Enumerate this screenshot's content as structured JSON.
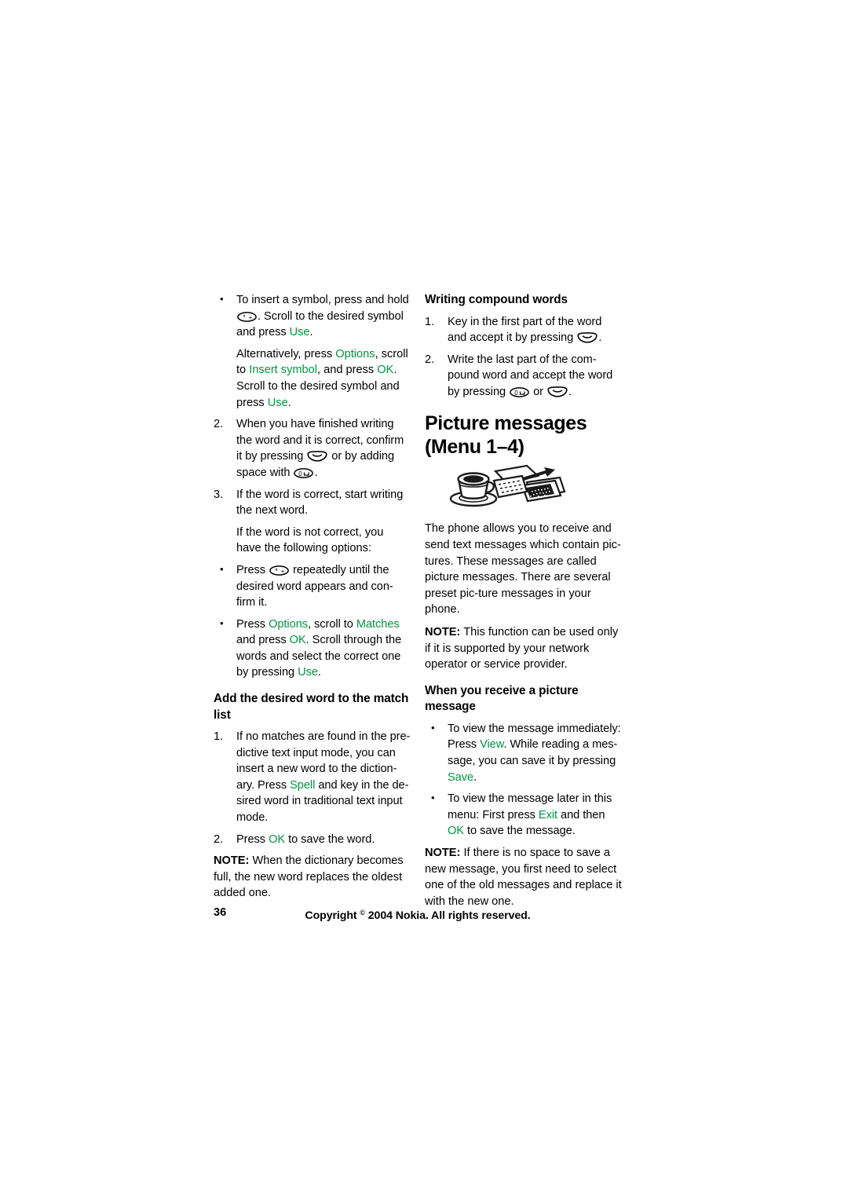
{
  "page": {
    "number": "36",
    "copyright_prefix": "Copyright",
    "copyright_symbol": "©",
    "copyright_suffix": "2004 Nokia. All rights reserved."
  },
  "accent_green": "#00963f",
  "left_column": {
    "bullet_insert_symbol": {
      "part1": "To insert a symbol, press and hold ",
      "key": "star-plus-key",
      "part2": ". Scroll to the desired symbol and press ",
      "link1": "Use",
      "part3": "."
    },
    "alternatively": {
      "part1": "Alternatively, press ",
      "link1": "Options",
      "part2": ", scroll to ",
      "link2": "Insert symbol",
      "part3": ", and press ",
      "link3": "OK",
      "part4": ". Scroll to the desired symbol and press ",
      "link4": "Use",
      "part5": "."
    },
    "step2": {
      "num": "2.",
      "part1": "When you have finished writing the word and it is correct, confirm it by pressing ",
      "key1": "select-key",
      "part2": " or by adding space with ",
      "key2": "zero-space-key",
      "part3": "."
    },
    "step3": {
      "num": "3.",
      "text": "If the word is correct, start writing the next word."
    },
    "not_correct": "If the word is not correct, you have the following options:",
    "bullet_press_star": {
      "part1": "Press ",
      "key": "star-plus-key",
      "part2": " repeatedly until the desired word appears and con-firm it."
    },
    "bullet_press_options": {
      "part1": "Press ",
      "link1": "Options",
      "part2": ", scroll to ",
      "link2": "Matches",
      "part3": " and press ",
      "link3": "OK",
      "part4": ". Scroll through the words and select the correct one by pressing ",
      "link4": "Use",
      "part5": "."
    },
    "heading_add_word": "Add the desired word to the match list",
    "add_step1": {
      "num": "1.",
      "part1": "If no matches are found in the pre-dictive text input mode, you can insert a new word to the diction-ary. Press ",
      "link1": "Spell",
      "part2": " and key in the de-sired word in traditional text input mode."
    },
    "add_step2": {
      "num": "2.",
      "part1": "Press ",
      "link1": "OK",
      "part2": " to save the word."
    },
    "note_dictionary": {
      "lead": "NOTE:",
      "text": " When the dictionary becomes full, the new word replaces the oldest added one."
    }
  },
  "right_column": {
    "heading_compound": "Writing compound words",
    "compound_step1": {
      "num": "1.",
      "part1": "Key in the first part of the word and accept it by pressing ",
      "key1": "select-key",
      "part2": "."
    },
    "compound_step2": {
      "num": "2.",
      "part1": "Write the last part of the com-pound word and accept the word by pressing ",
      "key1": "zero-space-key",
      "part2": " or ",
      "key2": "select-key",
      "part3": "."
    },
    "chapter_title_line1": "Picture messages",
    "chapter_title_line2": "(Menu 1–4)",
    "illustration": "coffee-cup-and-letters-illustration",
    "intro": "The phone allows you to receive and send text messages which contain pic-tures. These messages are called picture messages. There are several preset pic-ture messages in your phone.",
    "note_network": {
      "lead": "NOTE:",
      "text": " This function can be used only if it is supported by your network operator or service provider."
    },
    "heading_receive": "When you receive a picture message",
    "bullet_view_now": {
      "part1": "To view the message immediately: Press ",
      "link1": "View",
      "part2": ". While reading a mes-sage, you can save it by pressing ",
      "link2": "Save",
      "part3": "."
    },
    "bullet_view_later": {
      "part1": "To view the message later in this menu: First press ",
      "link1": "Exit",
      "part2": " and then ",
      "link2": "OK",
      "part3": " to save the message."
    },
    "note_no_space": {
      "lead": "NOTE:",
      "text": " If there is no space to save a new message, you first need to select one of the old messages and replace it with the new one."
    }
  }
}
